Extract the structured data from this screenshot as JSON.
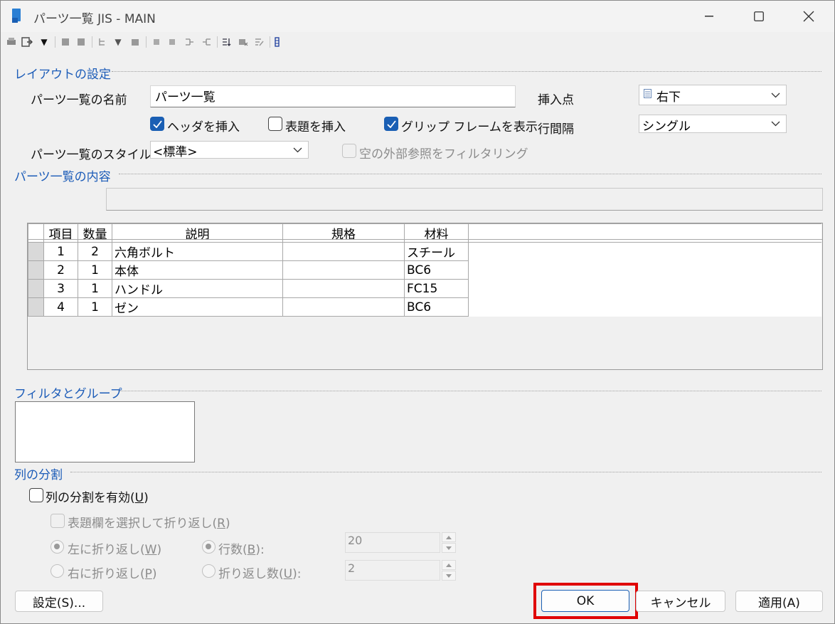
{
  "window": {
    "title": "パーツ一覧 JIS - MAIN"
  },
  "layout_group": {
    "title": "レイアウトの設定",
    "name_label": "パーツ一覧の名前",
    "name_value": "パーツ一覧",
    "insert_header_label": "ヘッダを挿入",
    "insert_header_checked": true,
    "insert_title_label": "表題を挿入",
    "insert_title_checked": false,
    "grip_frame_label": "グリップ フレームを表示",
    "grip_frame_checked": true,
    "insert_point_label": "挿入点",
    "insert_point_value": "右下",
    "line_spacing_label": "行間隔",
    "line_spacing_value": "シングル",
    "style_label": "パーツ一覧のスタイル",
    "style_value": "<標準>",
    "filter_xref_label": "空の外部参照をフィルタリング"
  },
  "content_group": {
    "title": "パーツ一覧の内容",
    "columns": [
      "項目",
      "数量",
      "説明",
      "規格",
      "材料"
    ],
    "rows": [
      [
        "1",
        "2",
        "六角ボルト",
        "",
        "スチール"
      ],
      [
        "2",
        "1",
        "本体",
        "",
        "BC6"
      ],
      [
        "3",
        "1",
        "ハンドル",
        "",
        "FC15"
      ],
      [
        "4",
        "1",
        "ゼン",
        "",
        "BC6"
      ]
    ]
  },
  "filter_group": {
    "title": "フィルタとグループ"
  },
  "split_group": {
    "title": "列の分割",
    "enable_label": "列の分割を有効",
    "enable_key": "U",
    "wrap_title_label": "表題欄を選択して折り返し",
    "wrap_title_key": "R",
    "wrap_left_label": "左に折り返し",
    "wrap_left_key": "W",
    "wrap_right_label": "右に折り返し",
    "wrap_right_key": "P",
    "rows_label": "行数",
    "rows_key": "B",
    "rows_value": "20",
    "wrap_count_label": "折り返し数",
    "wrap_count_key": "U",
    "wrap_count_value": "2"
  },
  "buttons": {
    "settings": "設定(S)...",
    "ok": "OK",
    "cancel": "キャンセル",
    "apply": "適用(A)"
  },
  "colors": {
    "accent": "#1a5fb4",
    "highlight": "#e00000",
    "group_title": "#1c5cb8"
  }
}
